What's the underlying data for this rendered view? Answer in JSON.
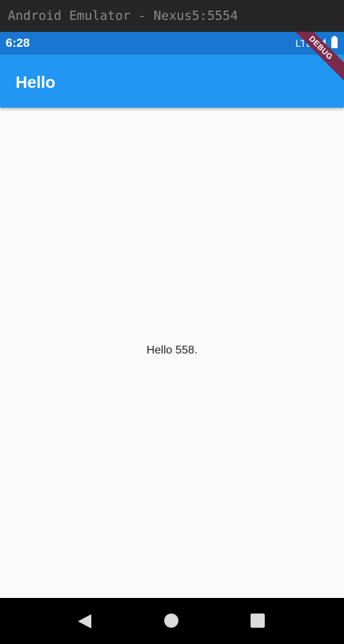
{
  "window": {
    "title": "Android Emulator - Nexus5:5554"
  },
  "status_bar": {
    "time": "6:28",
    "network": "LTE",
    "icons": [
      "signal-icon",
      "battery-icon"
    ]
  },
  "app_bar": {
    "title": "Hello"
  },
  "body": {
    "message": "Hello 558."
  },
  "debug_banner": {
    "label": "DEBUG"
  },
  "navigation": {
    "icons": [
      "back-icon",
      "home-icon",
      "recent-apps-icon"
    ]
  },
  "colors": {
    "status_bar": "#1976d2",
    "app_bar": "#2196f3",
    "background": "#fafafa",
    "debug_banner": "#7a2a4a"
  }
}
